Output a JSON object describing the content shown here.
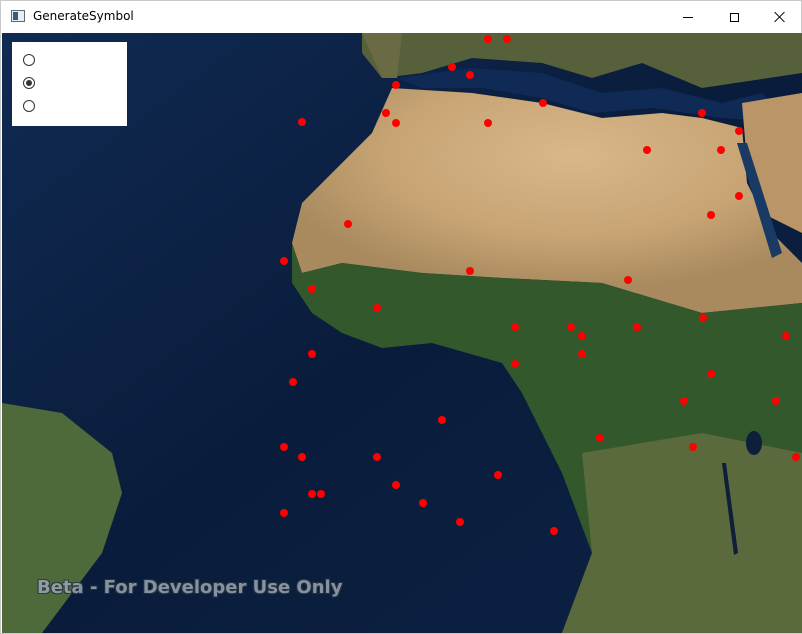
{
  "window": {
    "title": "GenerateSymbol",
    "minimize_icon": "minimize-icon",
    "maximize_icon": "maximize-icon",
    "close_icon": "close-icon"
  },
  "symbol_options": [
    {
      "label": "",
      "checked": false
    },
    {
      "label": "",
      "checked": true
    },
    {
      "label": "",
      "checked": false
    }
  ],
  "map": {
    "watermark": "Beta - For Developer Use Only",
    "marker_color": "#ff0000",
    "ocean_color": "#0b1e3d",
    "desert_color": "#c9a77a",
    "vegetation_color": "#2f5a2a"
  }
}
